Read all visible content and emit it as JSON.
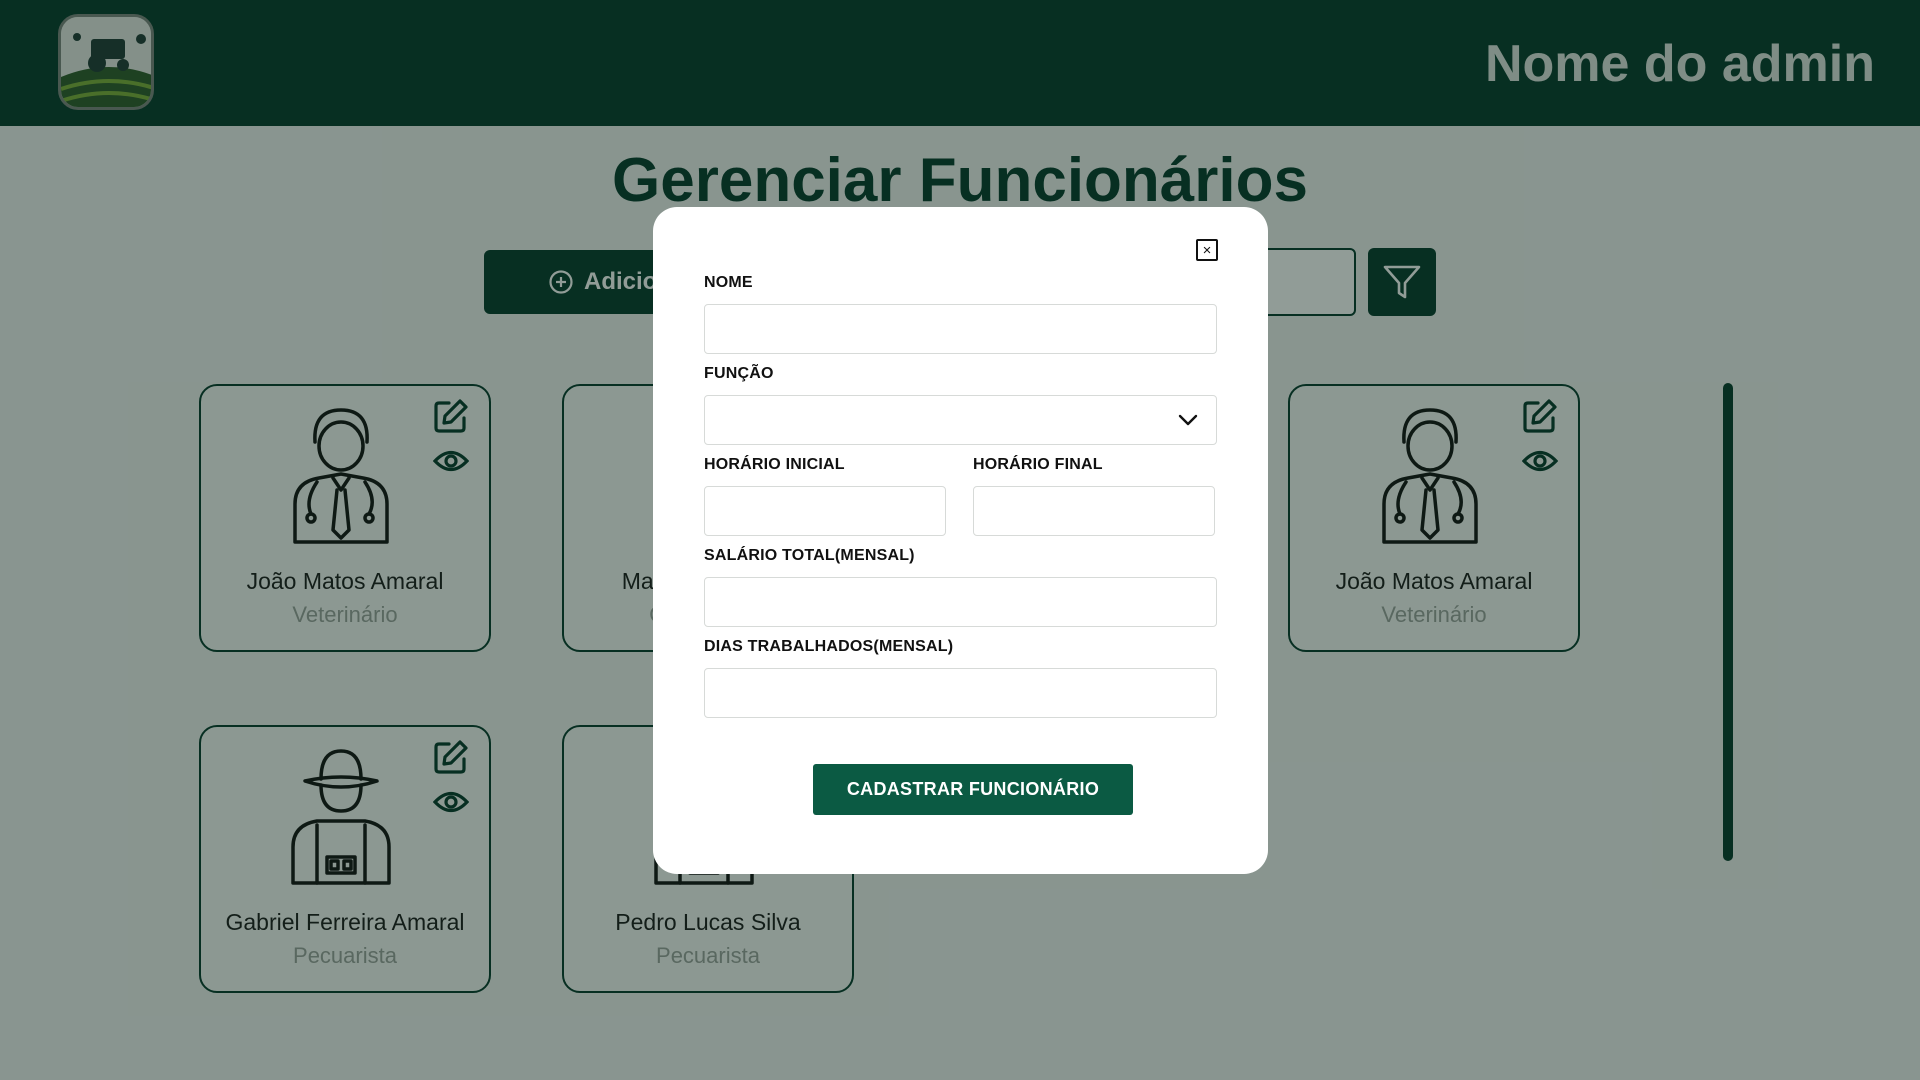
{
  "header": {
    "admin_name": "Nome do admin"
  },
  "page": {
    "title": "Gerenciar Funcionários",
    "add_button_label": "Adicionar Funcionário"
  },
  "employees": [
    {
      "name": "João Matos Amaral",
      "role": "Veterinário",
      "avatar": "veterinarian-icon"
    },
    {
      "name": "Matheus Oliveira",
      "role": "Ordenhador",
      "avatar": "worker-icon"
    },
    {
      "name": "João Matos Amaral",
      "role": "Veterinário",
      "avatar": "veterinarian-icon"
    },
    {
      "name": "Gabriel Ferreira Amaral",
      "role": "Pecuarista",
      "avatar": "rancher-icon"
    },
    {
      "name": "Pedro Lucas Silva",
      "role": "Pecuarista",
      "avatar": "rancher-icon"
    }
  ],
  "modal": {
    "close_label": "×",
    "fields": {
      "nome": {
        "label": "NOME",
        "value": ""
      },
      "funcao": {
        "label": "FUNÇÃO",
        "value": ""
      },
      "horario_inicial": {
        "label": "HORÁRIO INICIAL",
        "value": ""
      },
      "horario_final": {
        "label": "HORÁRIO FINAL",
        "value": ""
      },
      "salario": {
        "label": "SALÁRIO TOTAL(MENSAL)",
        "value": ""
      },
      "dias": {
        "label": "DIAS TRABALHADOS(MENSAL)",
        "value": ""
      }
    },
    "submit_label": "CADASTRAR FUNCIONÁRIO"
  },
  "colors": {
    "primary": "#05392b",
    "button": "#0b5a43"
  }
}
